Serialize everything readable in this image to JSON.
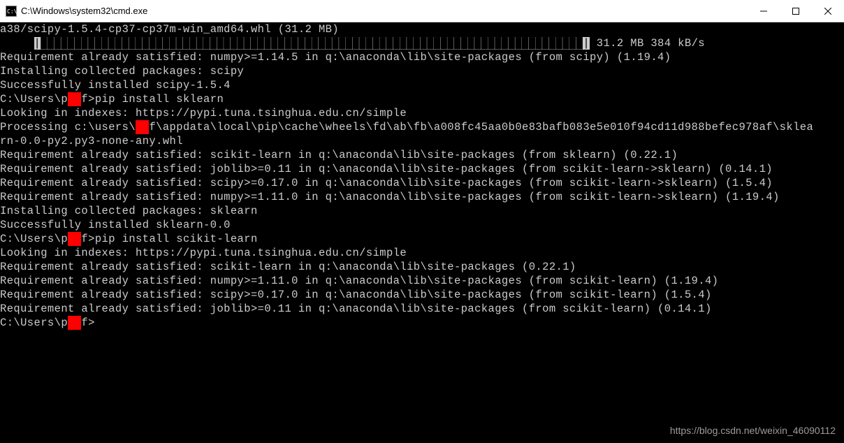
{
  "window": {
    "title": "C:\\Windows\\system32\\cmd.exe"
  },
  "term": {
    "l0_pre": "a38/scipy-1.5.4-cp37-cp37m-win_amd64.whl (31.2 MB)",
    "l1_pad": "     ",
    "l1_bar": "|████████████████████████████████████████████████████████████████████████████████|",
    "l1_post": " 31.2 MB 384 kB/s",
    "l2": "Requirement already satisfied: numpy>=1.14.5 in q:\\anaconda\\lib\\site-packages (from scipy) (1.19.4)",
    "l3": "Installing collected packages: scipy",
    "l4": "Successfully installed scipy-1.5.4",
    "blank": "",
    "p1a": "C:\\Users\\p",
    "red1": "  ",
    "p1b": "f>",
    "p1cmd": "pip install sklearn",
    "s1": "Looking in indexes: https://pypi.tuna.tsinghua.edu.cn/simple",
    "s2a": "Processing c:\\users\\",
    "s2b": "f\\appdata\\local\\pip\\cache\\wheels\\fd\\ab\\fb\\a008fc45aa0b0e83bafb083e5e010f94cd11d988befec978af\\sklea",
    "s3": "rn-0.0-py2.py3-none-any.whl",
    "s4": "Requirement already satisfied: scikit-learn in q:\\anaconda\\lib\\site-packages (from sklearn) (0.22.1)",
    "s5": "Requirement already satisfied: joblib>=0.11 in q:\\anaconda\\lib\\site-packages (from scikit-learn->sklearn) (0.14.1)",
    "s6": "Requirement already satisfied: scipy>=0.17.0 in q:\\anaconda\\lib\\site-packages (from scikit-learn->sklearn) (1.5.4)",
    "s7": "Requirement already satisfied: numpy>=1.11.0 in q:\\anaconda\\lib\\site-packages (from scikit-learn->sklearn) (1.19.4)",
    "s8": "Installing collected packages: sklearn",
    "s9": "Successfully installed sklearn-0.0",
    "p2cmd": "pip install scikit-learn",
    "t1": "Looking in indexes: https://pypi.tuna.tsinghua.edu.cn/simple",
    "t2": "Requirement already satisfied: scikit-learn in q:\\anaconda\\lib\\site-packages (0.22.1)",
    "t3": "Requirement already satisfied: numpy>=1.11.0 in q:\\anaconda\\lib\\site-packages (from scikit-learn) (1.19.4)",
    "t4": "Requirement already satisfied: scipy>=0.17.0 in q:\\anaconda\\lib\\site-packages (from scikit-learn) (1.5.4)",
    "t5": "Requirement already satisfied: joblib>=0.11 in q:\\anaconda\\lib\\site-packages (from scikit-learn) (0.14.1)"
  },
  "watermark": "https://blog.csdn.net/weixin_46090112"
}
